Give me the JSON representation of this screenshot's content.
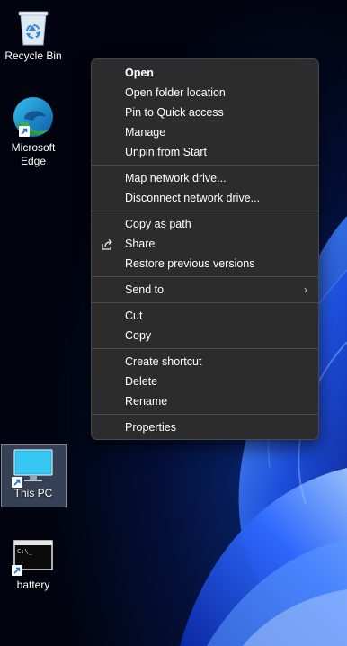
{
  "desktop": {
    "icons": [
      {
        "label": "Recycle Bin"
      },
      {
        "label": "Microsoft Edge"
      },
      {
        "label": "This PC"
      },
      {
        "label": "battery"
      }
    ]
  },
  "context_menu": {
    "group1": {
      "open": "Open",
      "open_folder_location": "Open folder location",
      "pin_quick_access": "Pin to Quick access",
      "manage": "Manage",
      "unpin_start": "Unpin from Start"
    },
    "group2": {
      "map_drive": "Map network drive...",
      "disconnect_drive": "Disconnect network drive..."
    },
    "group3": {
      "copy_as_path": "Copy as path",
      "share": "Share",
      "restore_versions": "Restore previous versions"
    },
    "group4": {
      "send_to": "Send to"
    },
    "group5": {
      "cut": "Cut",
      "copy": "Copy"
    },
    "group6": {
      "create_shortcut": "Create shortcut",
      "delete": "Delete",
      "rename": "Rename"
    },
    "group7": {
      "properties": "Properties"
    }
  },
  "colors": {
    "menu_bg": "#2c2c2c",
    "menu_border": "#4a4a4a",
    "wallpaper_dark": "#02071a",
    "wallpaper_accent": "#1f5fff"
  }
}
